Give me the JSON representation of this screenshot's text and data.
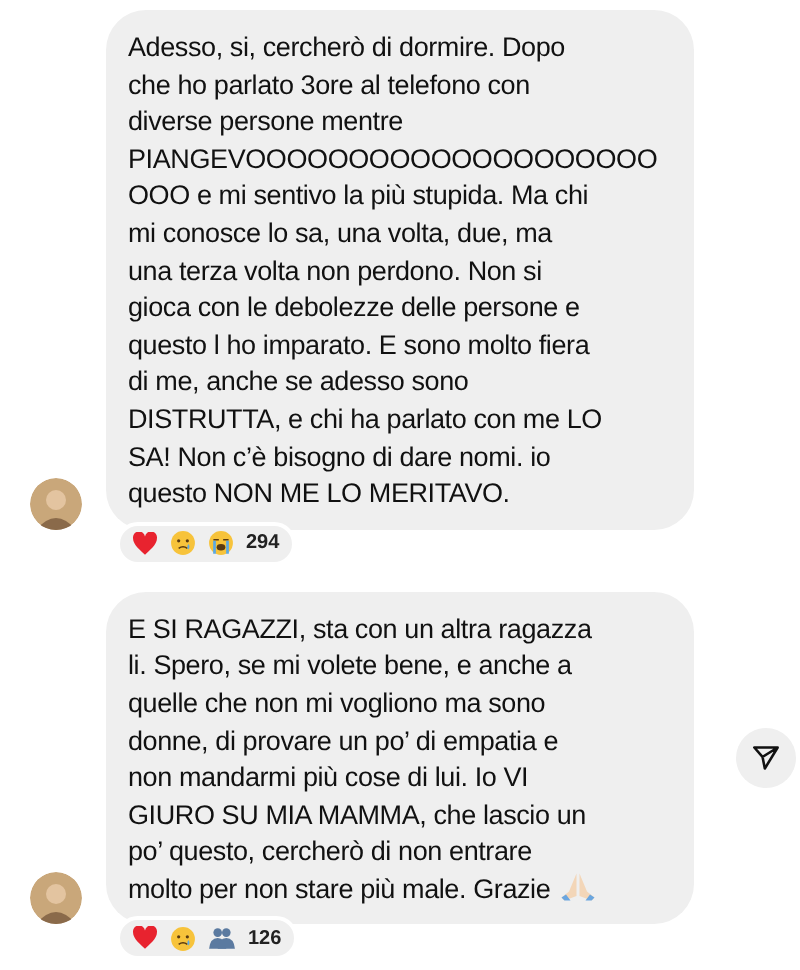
{
  "messages": [
    {
      "text": "Adesso, si, cercherò di dormire. Dopo\nche ho parlato 3ore al telefono con\ndiverse persone mentre\nPIANGEVOOOOOOOOOOOOOOOOOOOO\nOOO e mi sentivo la più stupida. Ma chi\nmi conosce lo sa, una volta, due, ma\nuna terza volta non perdono. Non si\ngioca con le debolezze delle persone e\nquesto l ho imparato. E sono molto fiera\ndi me, anche se adesso sono\nDISTRUTTA, e chi ha parlato con me LO\nSA! Non c’è bisogno di dare nomi. io\nquesto NON ME LO MERITAVO.",
      "trailing_emoji": false,
      "share_button": false,
      "reactions": {
        "emojis": [
          {
            "kind": "heart"
          },
          {
            "kind": "tear"
          },
          {
            "kind": "sob"
          }
        ],
        "count": "294"
      }
    },
    {
      "text": "E SI RAGAZZI, sta con un altra ragazza\nli. Spero, se mi volete bene, e anche a\nquelle che non mi vogliono ma sono\ndonne, di provare un po’ di empatia e\nnon mandarmi più cose di lui. Io VI\nGIURO SU MIA MAMMA, che lascio un\npo’ questo, cercherò di non entrare\nmolto per non stare più male. Grazie",
      "trailing_emoji": true,
      "share_button": true,
      "reactions": {
        "emojis": [
          {
            "kind": "heart"
          },
          {
            "kind": "tear"
          },
          {
            "kind": "people"
          }
        ],
        "count": "126"
      }
    }
  ]
}
